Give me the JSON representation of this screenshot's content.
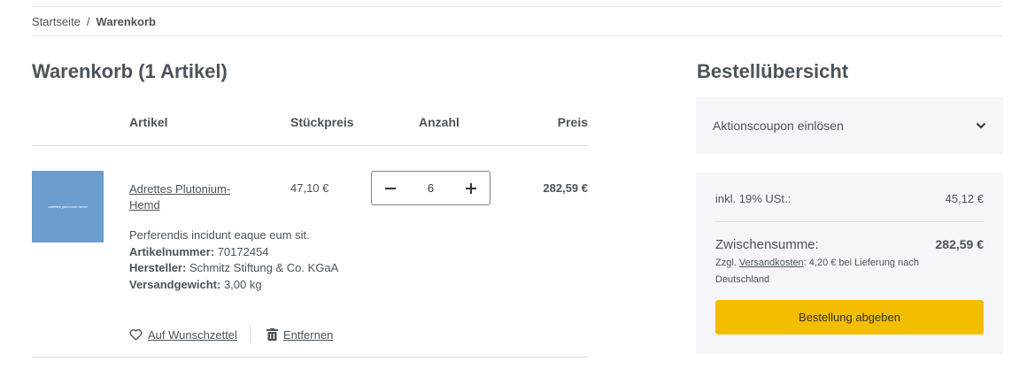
{
  "breadcrumb": {
    "home": "Startseite",
    "separator": "/",
    "current": "Warenkorb"
  },
  "cart": {
    "title": "Warenkorb (1 Artikel)",
    "columns": {
      "article": "Artikel",
      "unit_price": "Stückpreis",
      "quantity": "Anzahl",
      "price": "Preis"
    },
    "item": {
      "image_caption": "adrettes plutonium-hemd",
      "image_color": "#6b9dcf",
      "name": "Adrettes Plutonium-Hemd",
      "unit_price": "47,10 €",
      "quantity": "6",
      "total_price": "282,59 €",
      "description": "Perferendis incidunt eaque eum sit.",
      "article_number_label": "Artikelnummer:",
      "article_number": "70172454",
      "manufacturer_label": "Hersteller:",
      "manufacturer": "Schmitz Stiftung & Co. KGaA",
      "weight_label": "Versandgewicht:",
      "weight": "3,00 kg",
      "wishlist_label": "Auf Wunschzettel",
      "remove_label": "Entfernen"
    }
  },
  "summary": {
    "title": "Bestellübersicht",
    "coupon_label": "Aktionscoupon einlösen",
    "tax_label": "inkl. 19% USt.:",
    "tax_value": "45,12 €",
    "subtotal_label": "Zwischensumme:",
    "subtotal_value": "282,59 €",
    "shipping_prefix": "Zzgl.",
    "shipping_link": "Versandkosten",
    "shipping_suffix": ": 4,20 € bei Lieferung nach Deutschland",
    "checkout_label": "Bestellung abgeben",
    "checkout_color": "#f5bd00"
  },
  "icons": {
    "minus": "minus-icon",
    "plus": "plus-icon",
    "chevron": "chevron-down-icon",
    "heart": "heart-icon",
    "trash": "trash-icon"
  }
}
